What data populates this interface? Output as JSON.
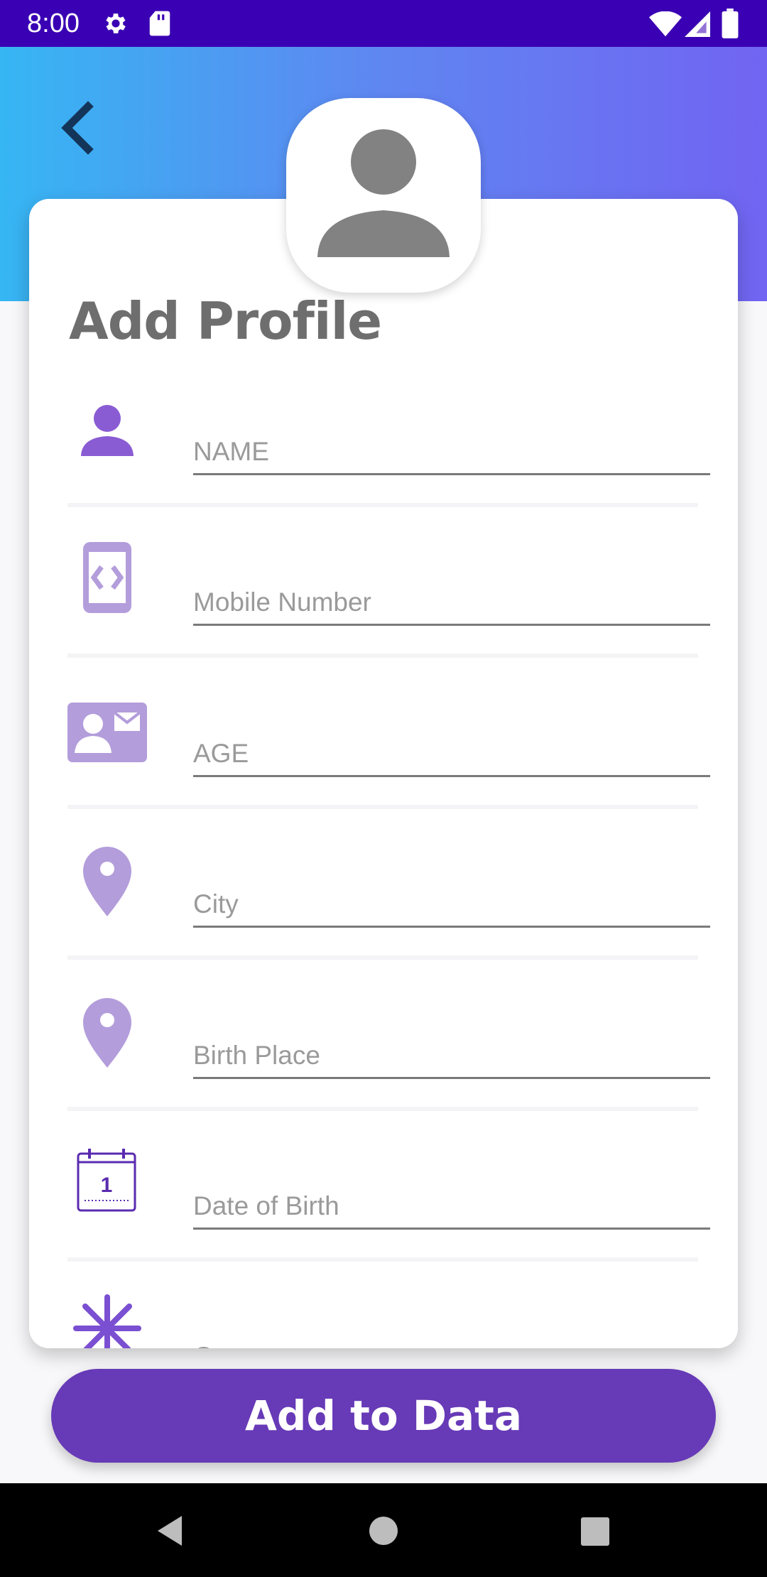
{
  "status_bar": {
    "time": "8:00",
    "icons": [
      "settings-icon",
      "sd-card-icon",
      "wifi-icon",
      "signal-icon",
      "battery-icon"
    ]
  },
  "header": {
    "back_icon": "chevron-left-icon",
    "avatar_icon": "person-avatar-icon",
    "gradient": [
      "#36b6f3",
      "#7164f2"
    ]
  },
  "form": {
    "title": "Add Profile",
    "fields": [
      {
        "icon": "person-icon",
        "placeholder": "NAME",
        "value": ""
      },
      {
        "icon": "mobile-phone-icon",
        "placeholder": "Mobile Number",
        "value": ""
      },
      {
        "icon": "contact-card-icon",
        "placeholder": "AGE",
        "value": ""
      },
      {
        "icon": "location-pin-icon",
        "placeholder": "City",
        "value": ""
      },
      {
        "icon": "location-pin-icon",
        "placeholder": "Birth Place",
        "value": ""
      },
      {
        "icon": "calendar-icon",
        "placeholder": "Date of Birth",
        "value": ""
      },
      {
        "icon": "snowflake-icon",
        "placeholder": "Gotra",
        "value": ""
      }
    ],
    "calendar_day": "1"
  },
  "submit": {
    "label": "Add to Data"
  },
  "nav_bar": {
    "icons": [
      "back-triangle-icon",
      "home-circle-icon",
      "recents-square-icon"
    ]
  },
  "colors": {
    "accent": "#673ab7",
    "status_bar": "#3a00b3",
    "icon_purple": "#b39ddb",
    "title_gray": "#6e6e6e"
  }
}
